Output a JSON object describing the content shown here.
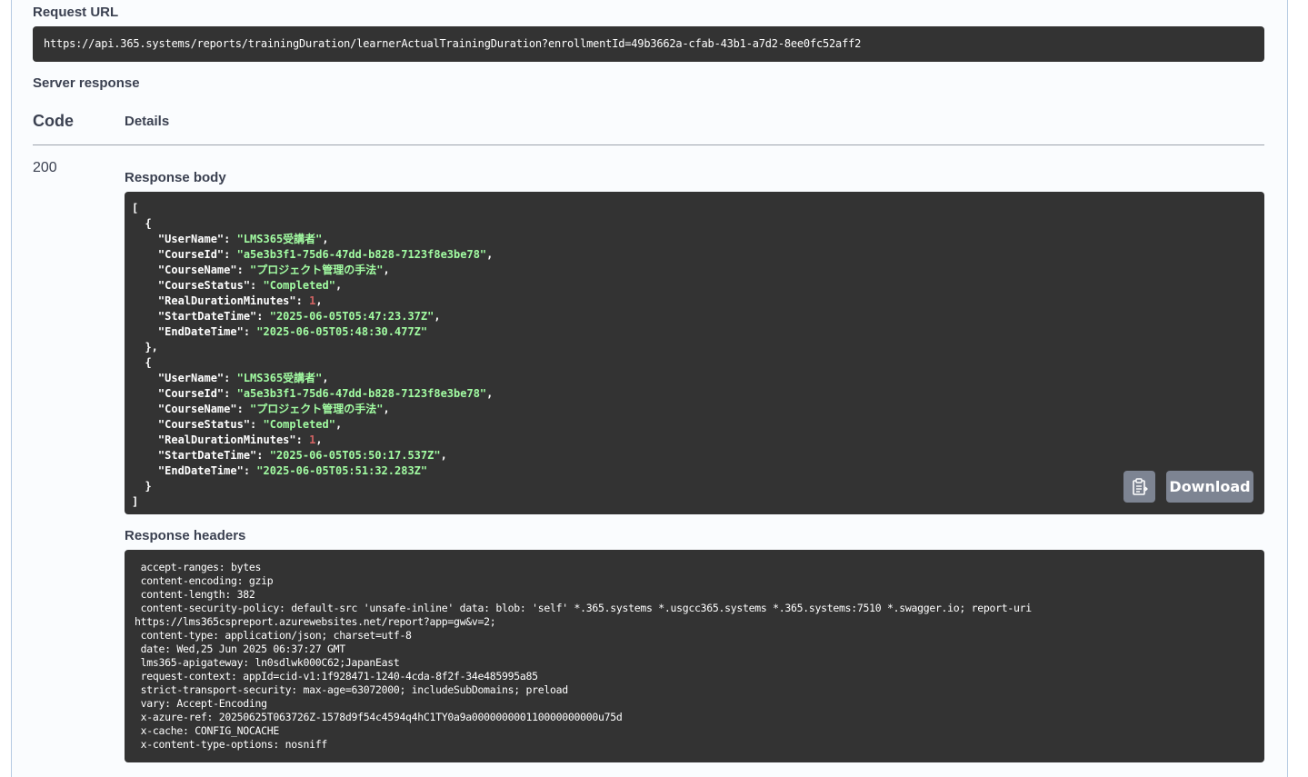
{
  "request_url": {
    "label": "Request URL",
    "value": "https://api.365.systems/reports/trainingDuration/learnerActualTrainingDuration?enrollmentId=49b3662a-cfab-43b1-a7d2-8ee0fc52aff2"
  },
  "server_response": {
    "label": "Server response",
    "col_code": "Code",
    "col_details": "Details",
    "status_code": "200"
  },
  "response_body": {
    "label": "Response body",
    "lines": [
      [
        {
          "t": "p",
          "v": "["
        }
      ],
      [
        {
          "t": "p",
          "v": "  {"
        }
      ],
      [
        {
          "t": "k",
          "v": "    \"UserName\""
        },
        {
          "t": "p",
          "v": ": "
        },
        {
          "t": "s",
          "v": "\"LMS365受講者\""
        },
        {
          "t": "p",
          "v": ","
        }
      ],
      [
        {
          "t": "k",
          "v": "    \"CourseId\""
        },
        {
          "t": "p",
          "v": ": "
        },
        {
          "t": "s",
          "v": "\"a5e3b3f1-75d6-47dd-b828-7123f8e3be78\""
        },
        {
          "t": "p",
          "v": ","
        }
      ],
      [
        {
          "t": "k",
          "v": "    \"CourseName\""
        },
        {
          "t": "p",
          "v": ": "
        },
        {
          "t": "s",
          "v": "\"プロジェクト管理の手法\""
        },
        {
          "t": "p",
          "v": ","
        }
      ],
      [
        {
          "t": "k",
          "v": "    \"CourseStatus\""
        },
        {
          "t": "p",
          "v": ": "
        },
        {
          "t": "s",
          "v": "\"Completed\""
        },
        {
          "t": "p",
          "v": ","
        }
      ],
      [
        {
          "t": "k",
          "v": "    \"RealDurationMinutes\""
        },
        {
          "t": "p",
          "v": ": "
        },
        {
          "t": "n",
          "v": "1"
        },
        {
          "t": "p",
          "v": ","
        }
      ],
      [
        {
          "t": "k",
          "v": "    \"StartDateTime\""
        },
        {
          "t": "p",
          "v": ": "
        },
        {
          "t": "s",
          "v": "\"2025-06-05T05:47:23.37Z\""
        },
        {
          "t": "p",
          "v": ","
        }
      ],
      [
        {
          "t": "k",
          "v": "    \"EndDateTime\""
        },
        {
          "t": "p",
          "v": ": "
        },
        {
          "t": "s",
          "v": "\"2025-06-05T05:48:30.477Z\""
        }
      ],
      [
        {
          "t": "p",
          "v": "  },"
        }
      ],
      [
        {
          "t": "p",
          "v": "  {"
        }
      ],
      [
        {
          "t": "k",
          "v": "    \"UserName\""
        },
        {
          "t": "p",
          "v": ": "
        },
        {
          "t": "s",
          "v": "\"LMS365受講者\""
        },
        {
          "t": "p",
          "v": ","
        }
      ],
      [
        {
          "t": "k",
          "v": "    \"CourseId\""
        },
        {
          "t": "p",
          "v": ": "
        },
        {
          "t": "s",
          "v": "\"a5e3b3f1-75d6-47dd-b828-7123f8e3be78\""
        },
        {
          "t": "p",
          "v": ","
        }
      ],
      [
        {
          "t": "k",
          "v": "    \"CourseName\""
        },
        {
          "t": "p",
          "v": ": "
        },
        {
          "t": "s",
          "v": "\"プロジェクト管理の手法\""
        },
        {
          "t": "p",
          "v": ","
        }
      ],
      [
        {
          "t": "k",
          "v": "    \"CourseStatus\""
        },
        {
          "t": "p",
          "v": ": "
        },
        {
          "t": "s",
          "v": "\"Completed\""
        },
        {
          "t": "p",
          "v": ","
        }
      ],
      [
        {
          "t": "k",
          "v": "    \"RealDurationMinutes\""
        },
        {
          "t": "p",
          "v": ": "
        },
        {
          "t": "n",
          "v": "1"
        },
        {
          "t": "p",
          "v": ","
        }
      ],
      [
        {
          "t": "k",
          "v": "    \"StartDateTime\""
        },
        {
          "t": "p",
          "v": ": "
        },
        {
          "t": "s",
          "v": "\"2025-06-05T05:50:17.537Z\""
        },
        {
          "t": "p",
          "v": ","
        }
      ],
      [
        {
          "t": "k",
          "v": "    \"EndDateTime\""
        },
        {
          "t": "p",
          "v": ": "
        },
        {
          "t": "s",
          "v": "\"2025-06-05T05:51:32.283Z\""
        }
      ],
      [
        {
          "t": "p",
          "v": "  }"
        }
      ],
      [
        {
          "t": "p",
          "v": "]"
        }
      ]
    ],
    "download_label": "Download",
    "copy_icon": "clipboard-icon"
  },
  "response_headers": {
    "label": "Response headers",
    "lines": [
      " accept-ranges: bytes",
      " content-encoding: gzip",
      " content-length: 382",
      " content-security-policy: default-src 'unsafe-inline' data: blob: 'self' *.365.systems *.usgcc365.systems *.365.systems:7510 *.swagger.io; report-uri",
      "https://lms365cspreport.azurewebsites.net/report?app=gw&v=2;",
      " content-type: application/json; charset=utf-8",
      " date: Wed,25 Jun 2025 06:37:27 GMT",
      " lms365-apigateway: ln0sdlwk000C62;JapanEast",
      " request-context: appId=cid-v1:1f928471-1240-4cda-8f2f-34e485995a85",
      " strict-transport-security: max-age=63072000; includeSubDomains; preload",
      " vary: Accept-Encoding",
      " x-azure-ref: 20250625T063726Z-1578d9f54c4594q4hC1TY0a9a000000000110000000000u75d",
      " x-cache: CONFIG_NOCACHE",
      " x-content-type-options: nosniff"
    ]
  },
  "colors": {
    "code_bg": "#333333",
    "string": "#a2fca2",
    "number": "#d36363",
    "button_bg": "#7d8492",
    "text": "#3b4151"
  }
}
